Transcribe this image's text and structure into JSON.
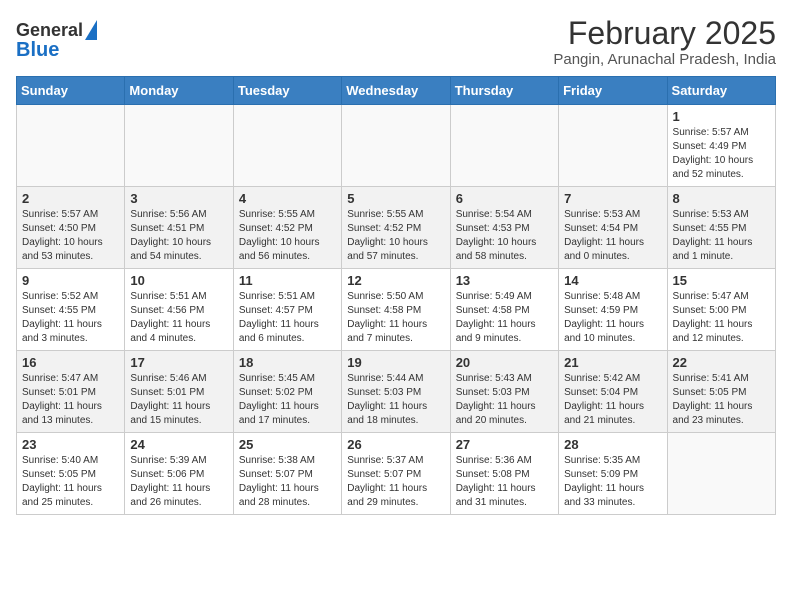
{
  "header": {
    "logo_general": "General",
    "logo_blue": "Blue",
    "title": "February 2025",
    "subtitle": "Pangin, Arunachal Pradesh, India"
  },
  "weekdays": [
    "Sunday",
    "Monday",
    "Tuesday",
    "Wednesday",
    "Thursday",
    "Friday",
    "Saturday"
  ],
  "weeks": [
    {
      "alt": false,
      "days": [
        {
          "num": "",
          "info": ""
        },
        {
          "num": "",
          "info": ""
        },
        {
          "num": "",
          "info": ""
        },
        {
          "num": "",
          "info": ""
        },
        {
          "num": "",
          "info": ""
        },
        {
          "num": "",
          "info": ""
        },
        {
          "num": "1",
          "info": "Sunrise: 5:57 AM\nSunset: 4:49 PM\nDaylight: 10 hours\nand 52 minutes."
        }
      ]
    },
    {
      "alt": true,
      "days": [
        {
          "num": "2",
          "info": "Sunrise: 5:57 AM\nSunset: 4:50 PM\nDaylight: 10 hours\nand 53 minutes."
        },
        {
          "num": "3",
          "info": "Sunrise: 5:56 AM\nSunset: 4:51 PM\nDaylight: 10 hours\nand 54 minutes."
        },
        {
          "num": "4",
          "info": "Sunrise: 5:55 AM\nSunset: 4:52 PM\nDaylight: 10 hours\nand 56 minutes."
        },
        {
          "num": "5",
          "info": "Sunrise: 5:55 AM\nSunset: 4:52 PM\nDaylight: 10 hours\nand 57 minutes."
        },
        {
          "num": "6",
          "info": "Sunrise: 5:54 AM\nSunset: 4:53 PM\nDaylight: 10 hours\nand 58 minutes."
        },
        {
          "num": "7",
          "info": "Sunrise: 5:53 AM\nSunset: 4:54 PM\nDaylight: 11 hours\nand 0 minutes."
        },
        {
          "num": "8",
          "info": "Sunrise: 5:53 AM\nSunset: 4:55 PM\nDaylight: 11 hours\nand 1 minute."
        }
      ]
    },
    {
      "alt": false,
      "days": [
        {
          "num": "9",
          "info": "Sunrise: 5:52 AM\nSunset: 4:55 PM\nDaylight: 11 hours\nand 3 minutes."
        },
        {
          "num": "10",
          "info": "Sunrise: 5:51 AM\nSunset: 4:56 PM\nDaylight: 11 hours\nand 4 minutes."
        },
        {
          "num": "11",
          "info": "Sunrise: 5:51 AM\nSunset: 4:57 PM\nDaylight: 11 hours\nand 6 minutes."
        },
        {
          "num": "12",
          "info": "Sunrise: 5:50 AM\nSunset: 4:58 PM\nDaylight: 11 hours\nand 7 minutes."
        },
        {
          "num": "13",
          "info": "Sunrise: 5:49 AM\nSunset: 4:58 PM\nDaylight: 11 hours\nand 9 minutes."
        },
        {
          "num": "14",
          "info": "Sunrise: 5:48 AM\nSunset: 4:59 PM\nDaylight: 11 hours\nand 10 minutes."
        },
        {
          "num": "15",
          "info": "Sunrise: 5:47 AM\nSunset: 5:00 PM\nDaylight: 11 hours\nand 12 minutes."
        }
      ]
    },
    {
      "alt": true,
      "days": [
        {
          "num": "16",
          "info": "Sunrise: 5:47 AM\nSunset: 5:01 PM\nDaylight: 11 hours\nand 13 minutes."
        },
        {
          "num": "17",
          "info": "Sunrise: 5:46 AM\nSunset: 5:01 PM\nDaylight: 11 hours\nand 15 minutes."
        },
        {
          "num": "18",
          "info": "Sunrise: 5:45 AM\nSunset: 5:02 PM\nDaylight: 11 hours\nand 17 minutes."
        },
        {
          "num": "19",
          "info": "Sunrise: 5:44 AM\nSunset: 5:03 PM\nDaylight: 11 hours\nand 18 minutes."
        },
        {
          "num": "20",
          "info": "Sunrise: 5:43 AM\nSunset: 5:03 PM\nDaylight: 11 hours\nand 20 minutes."
        },
        {
          "num": "21",
          "info": "Sunrise: 5:42 AM\nSunset: 5:04 PM\nDaylight: 11 hours\nand 21 minutes."
        },
        {
          "num": "22",
          "info": "Sunrise: 5:41 AM\nSunset: 5:05 PM\nDaylight: 11 hours\nand 23 minutes."
        }
      ]
    },
    {
      "alt": false,
      "days": [
        {
          "num": "23",
          "info": "Sunrise: 5:40 AM\nSunset: 5:05 PM\nDaylight: 11 hours\nand 25 minutes."
        },
        {
          "num": "24",
          "info": "Sunrise: 5:39 AM\nSunset: 5:06 PM\nDaylight: 11 hours\nand 26 minutes."
        },
        {
          "num": "25",
          "info": "Sunrise: 5:38 AM\nSunset: 5:07 PM\nDaylight: 11 hours\nand 28 minutes."
        },
        {
          "num": "26",
          "info": "Sunrise: 5:37 AM\nSunset: 5:07 PM\nDaylight: 11 hours\nand 29 minutes."
        },
        {
          "num": "27",
          "info": "Sunrise: 5:36 AM\nSunset: 5:08 PM\nDaylight: 11 hours\nand 31 minutes."
        },
        {
          "num": "28",
          "info": "Sunrise: 5:35 AM\nSunset: 5:09 PM\nDaylight: 11 hours\nand 33 minutes."
        },
        {
          "num": "",
          "info": ""
        }
      ]
    }
  ]
}
